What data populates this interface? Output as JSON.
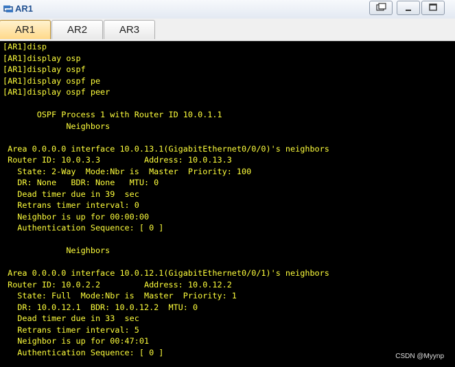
{
  "window": {
    "title": "AR1"
  },
  "tabs": [
    "AR1",
    "AR2",
    "AR3"
  ],
  "terminal_lines": [
    "[AR1]disp",
    "[AR1]display osp",
    "[AR1]display ospf",
    "[AR1]display ospf pe",
    "[AR1]display ospf peer",
    "",
    "       OSPF Process 1 with Router ID 10.0.1.1",
    "             Neighbors",
    "",
    " Area 0.0.0.0 interface 10.0.13.1(GigabitEthernet0/0/0)'s neighbors",
    " Router ID: 10.0.3.3         Address: 10.0.13.3",
    "   State: 2-Way  Mode:Nbr is  Master  Priority: 100",
    "   DR: None   BDR: None   MTU: 0",
    "   Dead timer due in 39  sec",
    "   Retrans timer interval: 0",
    "   Neighbor is up for 00:00:00",
    "   Authentication Sequence: [ 0 ]",
    "",
    "             Neighbors",
    "",
    " Area 0.0.0.0 interface 10.0.12.1(GigabitEthernet0/0/1)'s neighbors",
    " Router ID: 10.0.2.2         Address: 10.0.12.2",
    "   State: Full  Mode:Nbr is  Master  Priority: 1",
    "   DR: 10.0.12.1  BDR: 10.0.12.2  MTU: 0",
    "   Dead timer due in 33  sec",
    "   Retrans timer interval: 5",
    "   Neighbor is up for 00:47:01",
    "   Authentication Sequence: [ 0 ]"
  ],
  "watermark": "CSDN @Myynp",
  "colors": {
    "terminal_text": "#ffff3c",
    "terminal_bg": "#000000",
    "active_tab": "#ffd98a"
  },
  "icons": [
    "router-app-icon",
    "restore-icon",
    "minimize-icon",
    "maximize-icon"
  ]
}
